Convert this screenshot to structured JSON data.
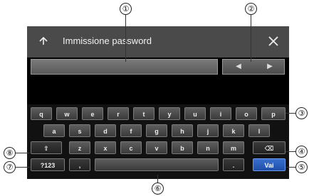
{
  "header": {
    "title": "Immissione password",
    "back_icon": "back-arrow-icon",
    "close_icon": "close-icon"
  },
  "input": {
    "value": ""
  },
  "cursor_arrows": {
    "left": "◀",
    "right": "▶"
  },
  "keyboard": {
    "row1": [
      "q",
      "w",
      "e",
      "r",
      "t",
      "y",
      "u",
      "i",
      "o",
      "p"
    ],
    "row2": [
      "a",
      "s",
      "d",
      "f",
      "g",
      "h",
      "j",
      "k",
      "l"
    ],
    "row3": [
      "z",
      "x",
      "c",
      "v",
      "b",
      "n",
      "m"
    ],
    "shift_label": "⇧",
    "numbers_label": "?123",
    "comma_label": ",",
    "period_label": ".",
    "delete_label": "⌫",
    "go_label": "Vai"
  },
  "callouts": [
    "①",
    "②",
    "③",
    "④",
    "⑤",
    "⑥",
    "⑦",
    "⑧"
  ]
}
